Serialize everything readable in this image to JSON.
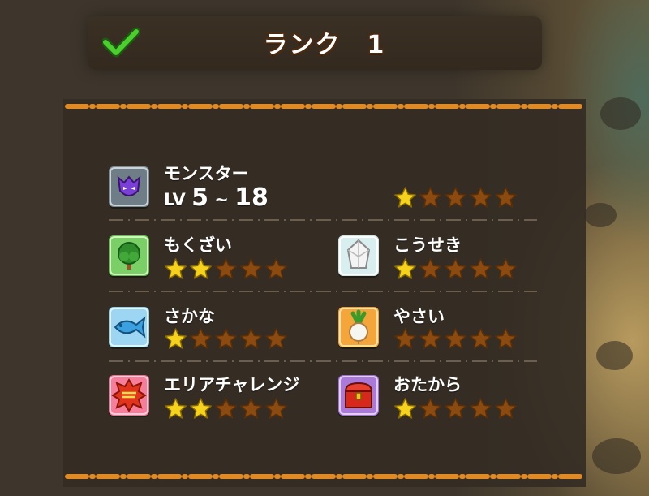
{
  "header": {
    "title": "ランク　1"
  },
  "categories": [
    {
      "id": "monster",
      "label": "モンスター",
      "icon": "monster-icon",
      "lv_prefix": "LV",
      "lv_min": "5",
      "lv_sep": "~",
      "lv_max": "18",
      "stars": 1,
      "max_stars": 5
    },
    {
      "id": "wood",
      "label": "もくざい",
      "icon": "tree-icon",
      "stars": 2,
      "max_stars": 5
    },
    {
      "id": "ore",
      "label": "こうせき",
      "icon": "crystal-icon",
      "stars": 1,
      "max_stars": 5
    },
    {
      "id": "fish",
      "label": "さかな",
      "icon": "fish-icon",
      "stars": 1,
      "max_stars": 5
    },
    {
      "id": "veg",
      "label": "やさい",
      "icon": "turnip-icon",
      "stars": 0,
      "max_stars": 5
    },
    {
      "id": "challenge",
      "label": "エリアチャレンジ",
      "icon": "challenge-icon",
      "stars": 2,
      "max_stars": 5
    },
    {
      "id": "treasure",
      "label": "おたから",
      "icon": "treasure-chest-icon",
      "stars": 1,
      "max_stars": 5
    }
  ],
  "colors": {
    "star_filled": "#f5d21c",
    "star_empty": "#8a4a10",
    "dash": "#e08a26",
    "panel": "#342d24"
  }
}
